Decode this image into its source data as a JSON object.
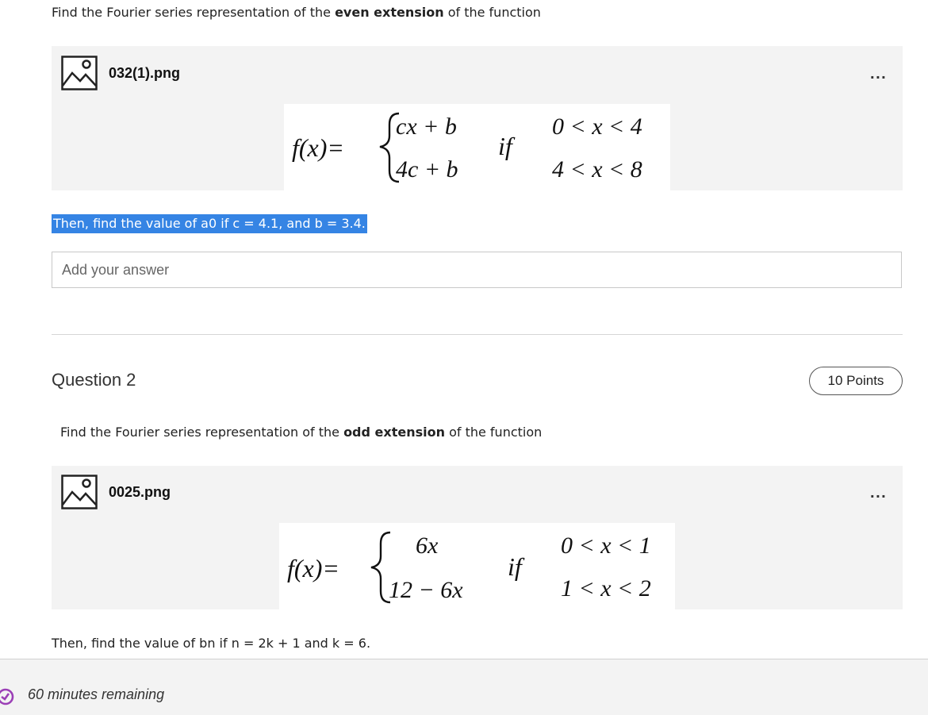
{
  "question1": {
    "prompt_pre": "Find the Fourier series representation of the ",
    "prompt_bold": "even extension",
    "prompt_post": " of the function",
    "attachment": {
      "file_name": "032(1).png",
      "icon": "image-file-icon",
      "more": "..."
    },
    "equation": {
      "lhs": "f(x)=",
      "case1_expr": "cx + b",
      "case2_expr": "4c + b",
      "condition_word": "if",
      "case1_cond": "0 < x < 4",
      "case2_cond": "4 < x < 8"
    },
    "sub_question": "Then, find the value of a0 if c = 4.1, and b = 3.4.",
    "answer_placeholder": "Add your answer"
  },
  "question2": {
    "title": "Question 2",
    "points": "10 Points",
    "prompt_pre": "Find the Fourier series representation of the ",
    "prompt_bold": "odd extension",
    "prompt_post": " of the function",
    "attachment": {
      "file_name": "0025.png",
      "icon": "image-file-icon",
      "more": "..."
    },
    "equation": {
      "lhs": "f(x)=",
      "case1_expr": "6x",
      "case2_expr": "12 − 6x",
      "condition_word": "if",
      "case1_cond": "0 < x < 1",
      "case2_cond": "1 < x < 2"
    },
    "sub_question": "Then, find the value of bn if n = 2k + 1 and k = 6."
  },
  "footer": {
    "timer_icon": "timer-icon",
    "timer_text": "60 minutes remaining",
    "accent_color": "#9b3fb6"
  }
}
